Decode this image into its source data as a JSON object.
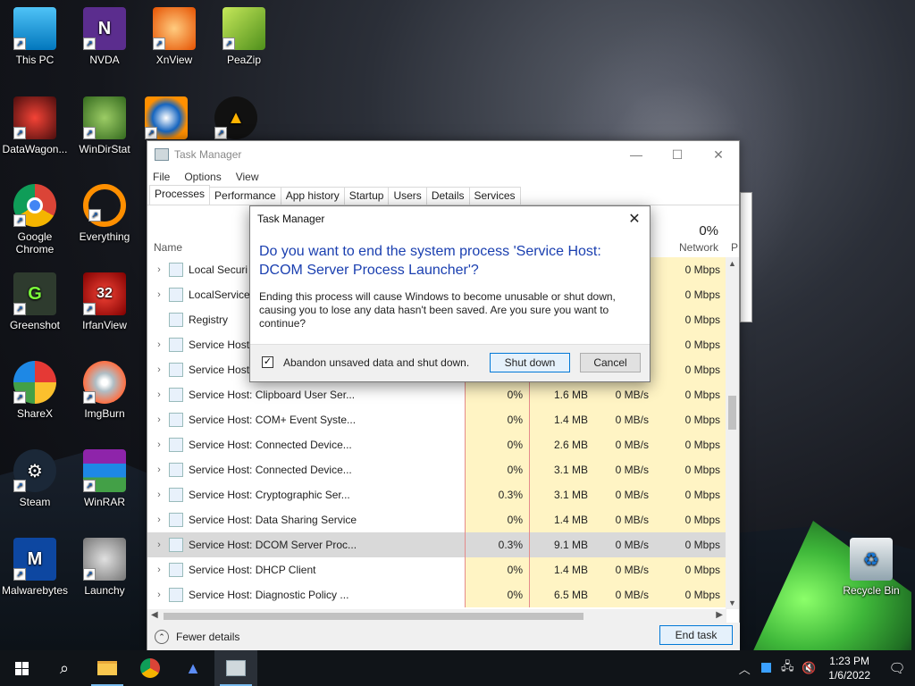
{
  "desktop": {
    "icons": [
      {
        "label": "This PC"
      },
      {
        "label": "NVDA"
      },
      {
        "label": "XnView"
      },
      {
        "label": "PeaZip"
      },
      {
        "label": "DataWagon..."
      },
      {
        "label": "WinDirStat"
      },
      {
        "label": "Google Chrome"
      },
      {
        "label": "Everything"
      },
      {
        "label": "Greenshot"
      },
      {
        "label": "IrfanView"
      },
      {
        "label": "ShareX"
      },
      {
        "label": "ImgBurn"
      },
      {
        "label": "Steam"
      },
      {
        "label": "WinRAR"
      },
      {
        "label": "Malwarebytes"
      },
      {
        "label": "Launchy"
      },
      {
        "label": "Recycle Bin"
      }
    ]
  },
  "taskmanager": {
    "title": "Task Manager",
    "menu": [
      "File",
      "Options",
      "View"
    ],
    "tabs": [
      "Processes",
      "Performance",
      "App history",
      "Startup",
      "Users",
      "Details",
      "Services"
    ],
    "column_name": "Name",
    "network_pct": "0%",
    "network_label": "Network",
    "p_label": "P",
    "rows": [
      {
        "name": "Local Securi",
        "cpu": "",
        "mem": "",
        "disk": "",
        "net": "0 Mbps"
      },
      {
        "name": "LocalService",
        "cpu": "",
        "mem": "",
        "disk": "",
        "net": "0 Mbps"
      },
      {
        "name": "Registry",
        "cpu": "",
        "mem": "",
        "disk": "",
        "net": "0 Mbps"
      },
      {
        "name": "Service Host",
        "cpu": "",
        "mem": "",
        "disk": "",
        "net": "0 Mbps"
      },
      {
        "name": "Service Host",
        "cpu": "",
        "mem": "",
        "disk": "",
        "net": "0 Mbps"
      },
      {
        "name": "Service Host: Clipboard User Ser...",
        "cpu": "0%",
        "mem": "1.6 MB",
        "disk": "0 MB/s",
        "net": "0 Mbps"
      },
      {
        "name": "Service Host: COM+ Event Syste...",
        "cpu": "0%",
        "mem": "1.4 MB",
        "disk": "0 MB/s",
        "net": "0 Mbps"
      },
      {
        "name": "Service Host: Connected Device...",
        "cpu": "0%",
        "mem": "2.6 MB",
        "disk": "0 MB/s",
        "net": "0 Mbps"
      },
      {
        "name": "Service Host: Connected Device...",
        "cpu": "0%",
        "mem": "3.1 MB",
        "disk": "0 MB/s",
        "net": "0 Mbps"
      },
      {
        "name": "Service Host: Cryptographic Ser...",
        "cpu": "0.3%",
        "mem": "3.1 MB",
        "disk": "0 MB/s",
        "net": "0 Mbps"
      },
      {
        "name": "Service Host: Data Sharing Service",
        "cpu": "0%",
        "mem": "1.4 MB",
        "disk": "0 MB/s",
        "net": "0 Mbps"
      },
      {
        "name": "Service Host: DCOM Server Proc...",
        "cpu": "0.3%",
        "mem": "9.1 MB",
        "disk": "0 MB/s",
        "net": "0 Mbps"
      },
      {
        "name": "Service Host: DHCP Client",
        "cpu": "0%",
        "mem": "1.4 MB",
        "disk": "0 MB/s",
        "net": "0 Mbps"
      },
      {
        "name": "Service Host: Diagnostic Policy ...",
        "cpu": "0%",
        "mem": "6.5 MB",
        "disk": "0 MB/s",
        "net": "0 Mbps"
      }
    ],
    "fewer_details": "Fewer details",
    "end_task": "End task"
  },
  "dialog": {
    "title": "Task Manager",
    "heading": "Do you want to end the system process 'Service Host: DCOM Server Process Launcher'?",
    "body": "Ending this process will cause Windows to become unusable or shut down, causing you to lose any data hasn't been saved. Are you sure you want to continue?",
    "checkbox_label": "Abandon unsaved data and shut down.",
    "checkbox_checked": true,
    "primary_button": "Shut down",
    "cancel_button": "Cancel"
  },
  "taskbar": {
    "time": "1:23 PM",
    "date": "1/6/2022"
  },
  "colors": {
    "accent": "#0078d7",
    "heading_blue": "#1a3fb0",
    "heatmap_yellow": "#fff4c4"
  }
}
